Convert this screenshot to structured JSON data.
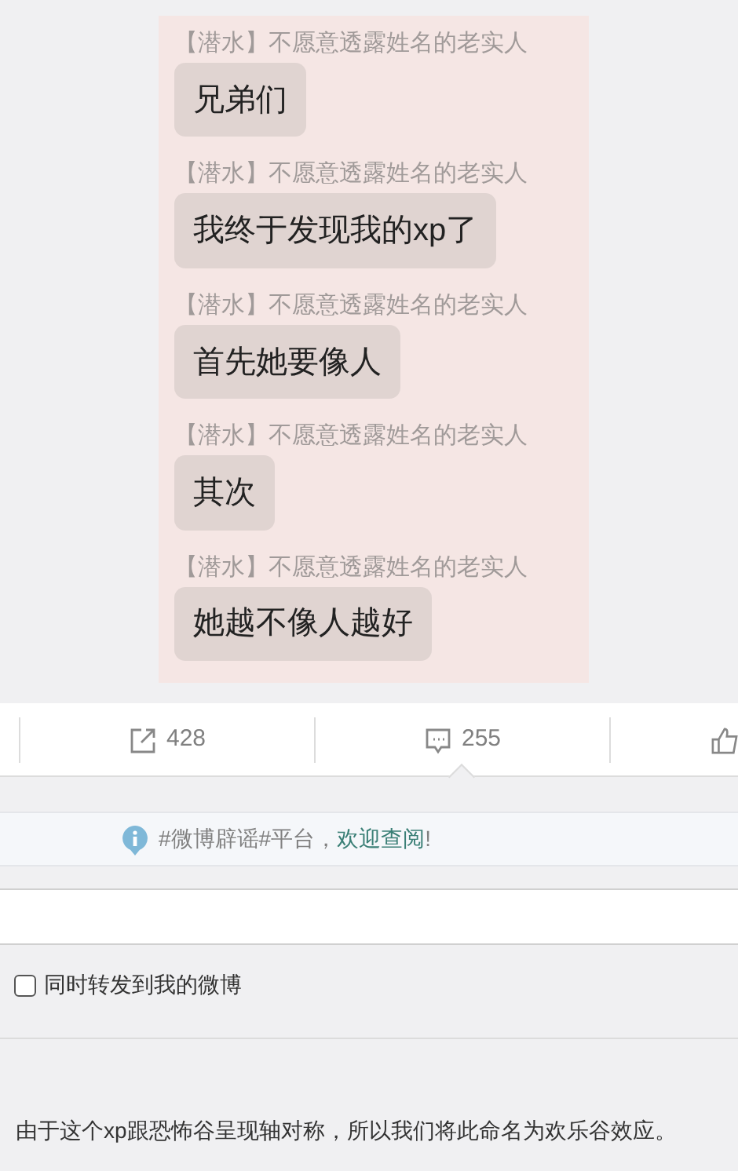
{
  "chat_image": {
    "messages": [
      {
        "sender": "【潜水】不愿意透露姓名的老实人",
        "text": "兄弟们"
      },
      {
        "sender": "【潜水】不愿意透露姓名的老实人",
        "text": "我终于发现我的xp了"
      },
      {
        "sender": "【潜水】不愿意透露姓名的老实人",
        "text": "首先她要像人"
      },
      {
        "sender": "【潜水】不愿意透露姓名的老实人",
        "text": "其次"
      },
      {
        "sender": "【潜水】不愿意透露姓名的老实人",
        "text": "她越不像人越好"
      }
    ]
  },
  "actions": [
    {
      "kind": "share",
      "count": "428",
      "selected": false
    },
    {
      "kind": "comment",
      "count": "255",
      "selected": true
    },
    {
      "kind": "like",
      "selected": false
    }
  ],
  "notice": {
    "text": "#微博辟谣#平台，",
    "link": "欢迎查阅",
    " end": "!"
  },
  "repost_option": {
    "label": "同时转发到我的微博",
    "checked": false
  },
  "comment": {
    "text": "由于这个xp跟恐怖谷呈现轴对称，所以我们将此命名为欢乐谷效应。"
  }
}
